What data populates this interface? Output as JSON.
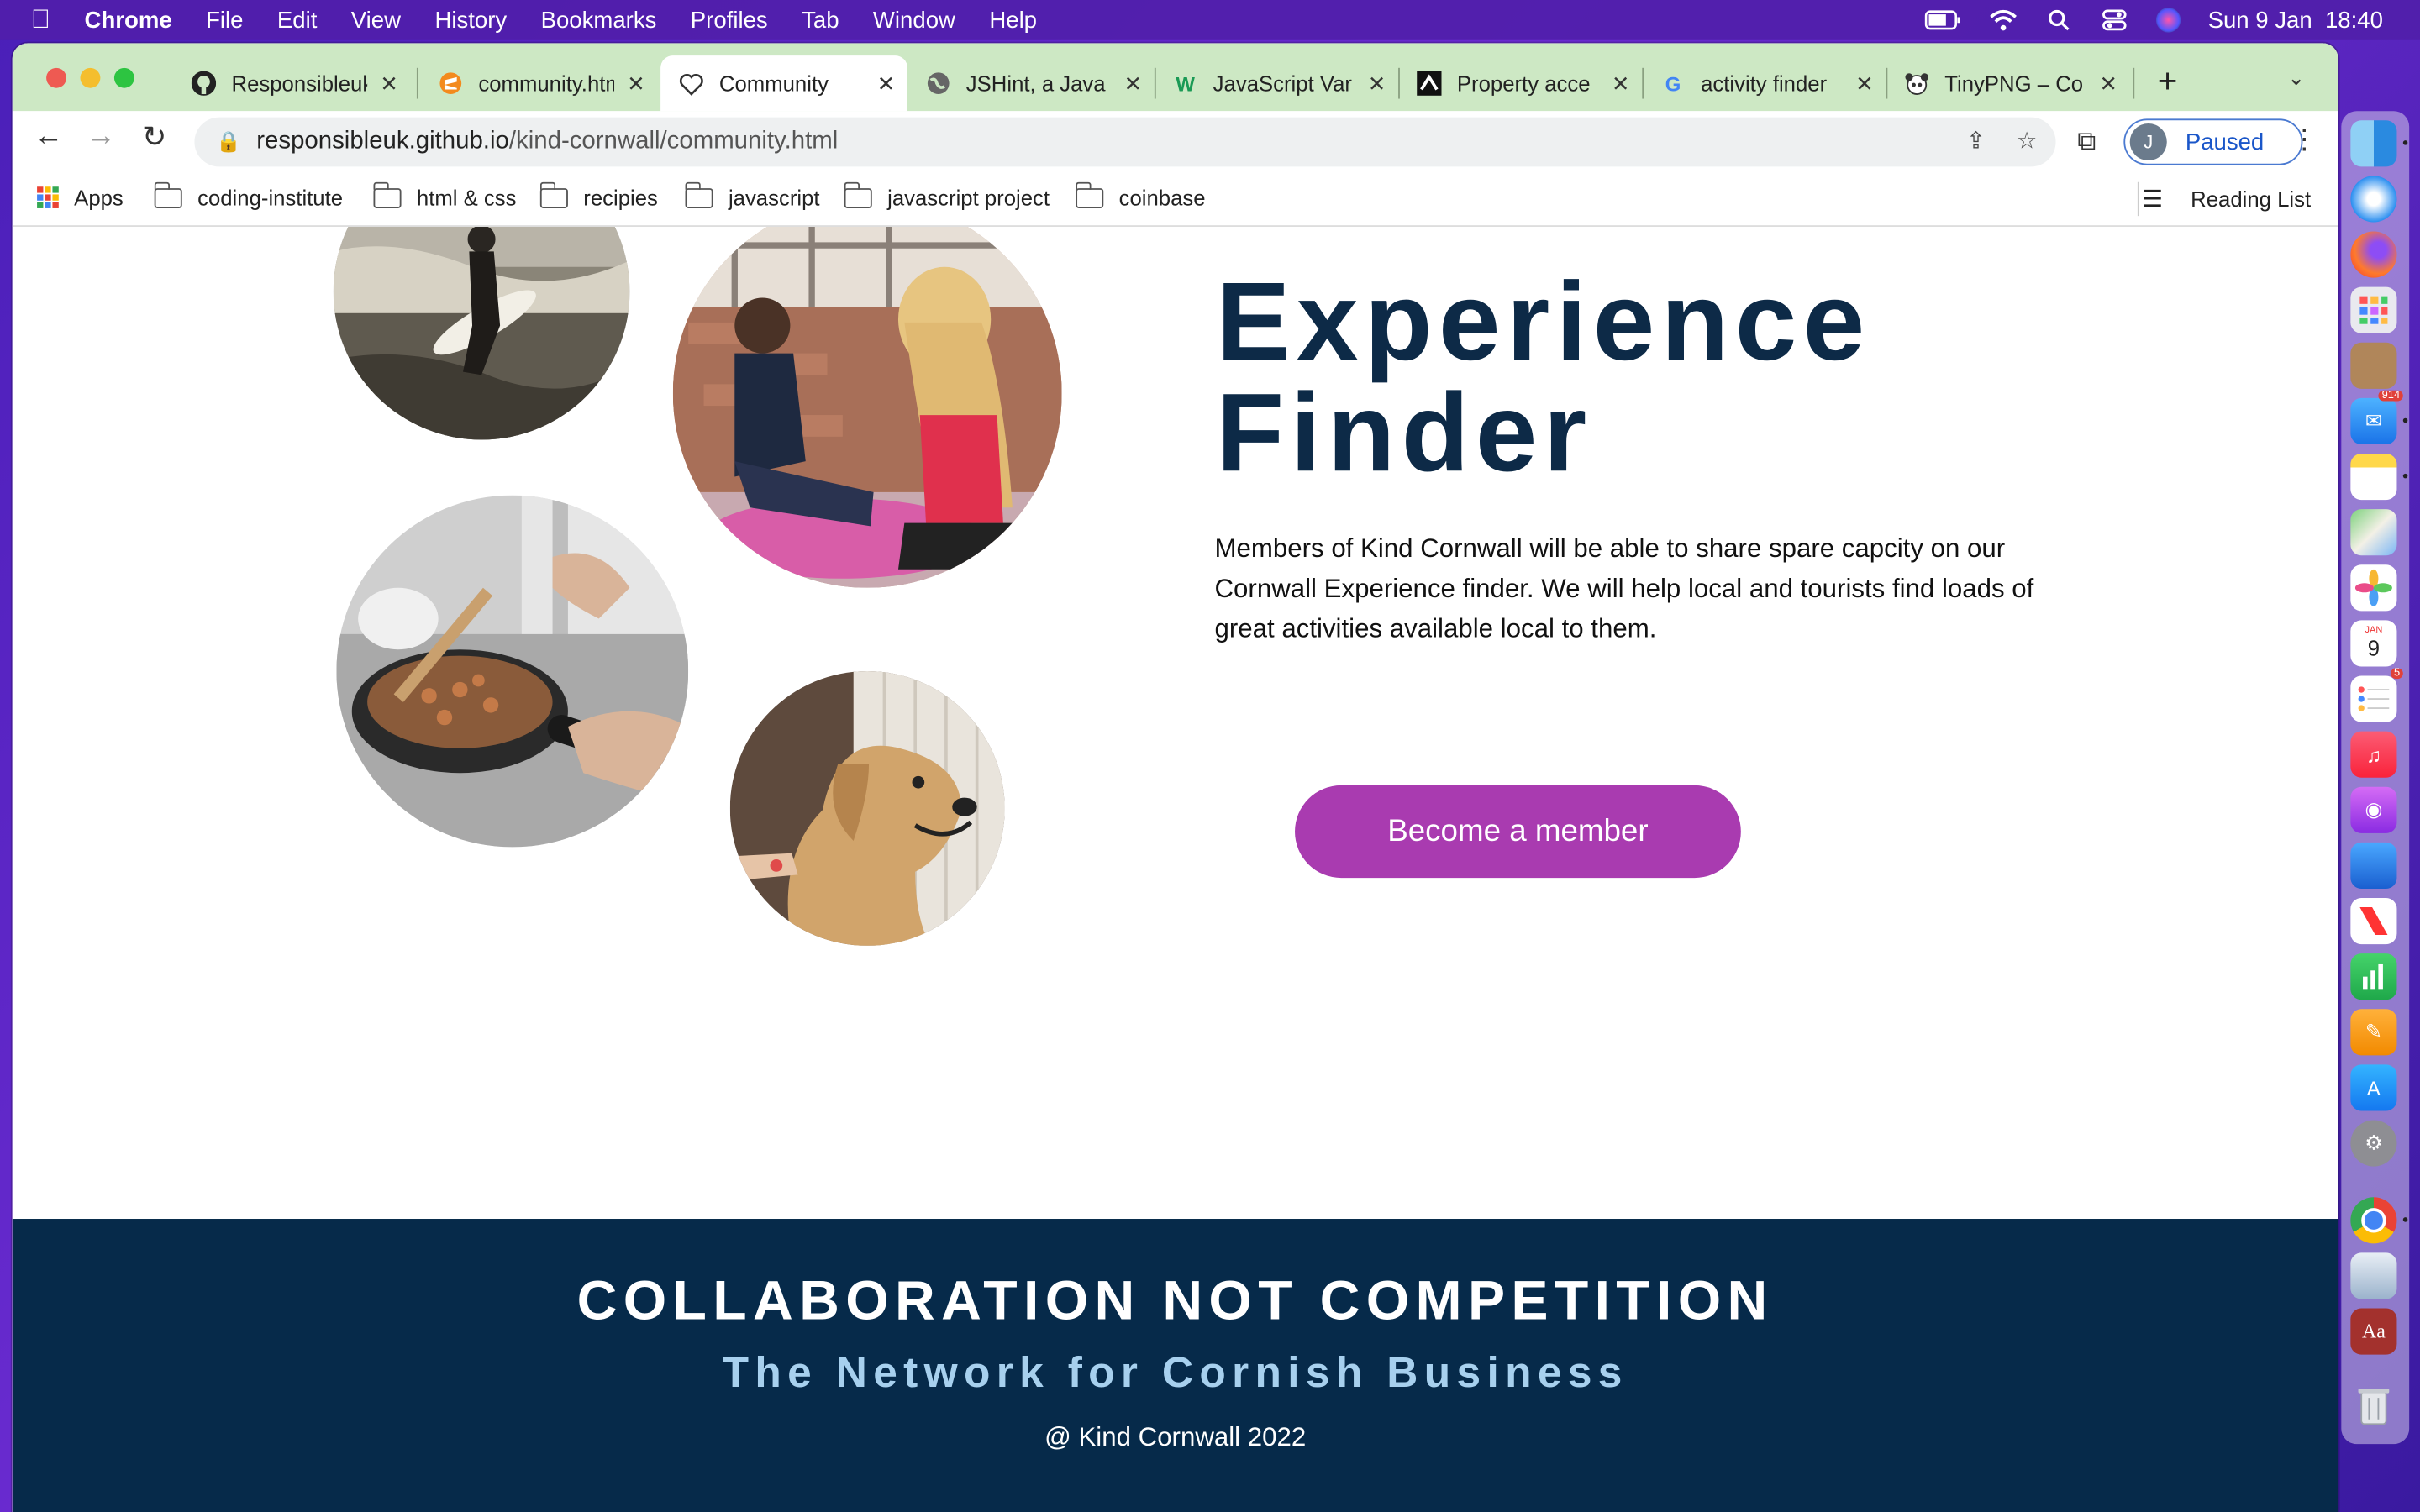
{
  "menubar": {
    "app": "Chrome",
    "items": [
      "File",
      "Edit",
      "View",
      "History",
      "Bookmarks",
      "Profiles",
      "Tab",
      "Window",
      "Help"
    ],
    "datetime": "Sun 9 Jan  18:40"
  },
  "tabs": [
    {
      "title": "Responsibleuk",
      "icon": "github-icon"
    },
    {
      "title": "community.htm",
      "icon": "sublime-icon"
    },
    {
      "title": "Community",
      "icon": "heart-icon",
      "active": true
    },
    {
      "title": "JSHint, a Java",
      "icon": "globe-icon"
    },
    {
      "title": "JavaScript Var",
      "icon": "w3schools-icon"
    },
    {
      "title": "Property acce",
      "icon": "mdn-icon"
    },
    {
      "title": "activity finder",
      "icon": "google-icon"
    },
    {
      "title": "TinyPNG – Co",
      "icon": "panda-icon"
    }
  ],
  "address": {
    "domain": "responsibleuk.github.io",
    "path": "/kind-cornwall/community.html"
  },
  "profile": {
    "initial": "J",
    "label": "Paused"
  },
  "bookmarks": {
    "apps": "Apps",
    "folders": [
      "coding-institute",
      "html & css",
      "recipies",
      "javascript",
      "javascript project",
      "coinbase"
    ],
    "reading_list": "Reading List"
  },
  "hero": {
    "title_line1": "Experience",
    "title_line2": "Finder",
    "body": "Members of Kind Cornwall will be able to share spare capcity on our Cornwall Experience finder. We will help local and tourists find loads of great activities available local to them.",
    "cta": "Become a member"
  },
  "footer": {
    "heading": "COLLABORATION NOT COMPETITION",
    "subheading": "The Network for Cornish Business",
    "copyright": "@ Kind Cornwall 2022"
  },
  "dock": {
    "mail_badge": "914",
    "calendar_month": "JAN",
    "calendar_day": "9",
    "reminders_badge": "5",
    "dictionary_label": "Aa"
  },
  "colors": {
    "accent": "#a93bb0",
    "navy": "#0d2a47",
    "footer_bg": "#062a4a",
    "footer_sub": "#a7d0ee",
    "tabstrip": "#cde8c4"
  }
}
